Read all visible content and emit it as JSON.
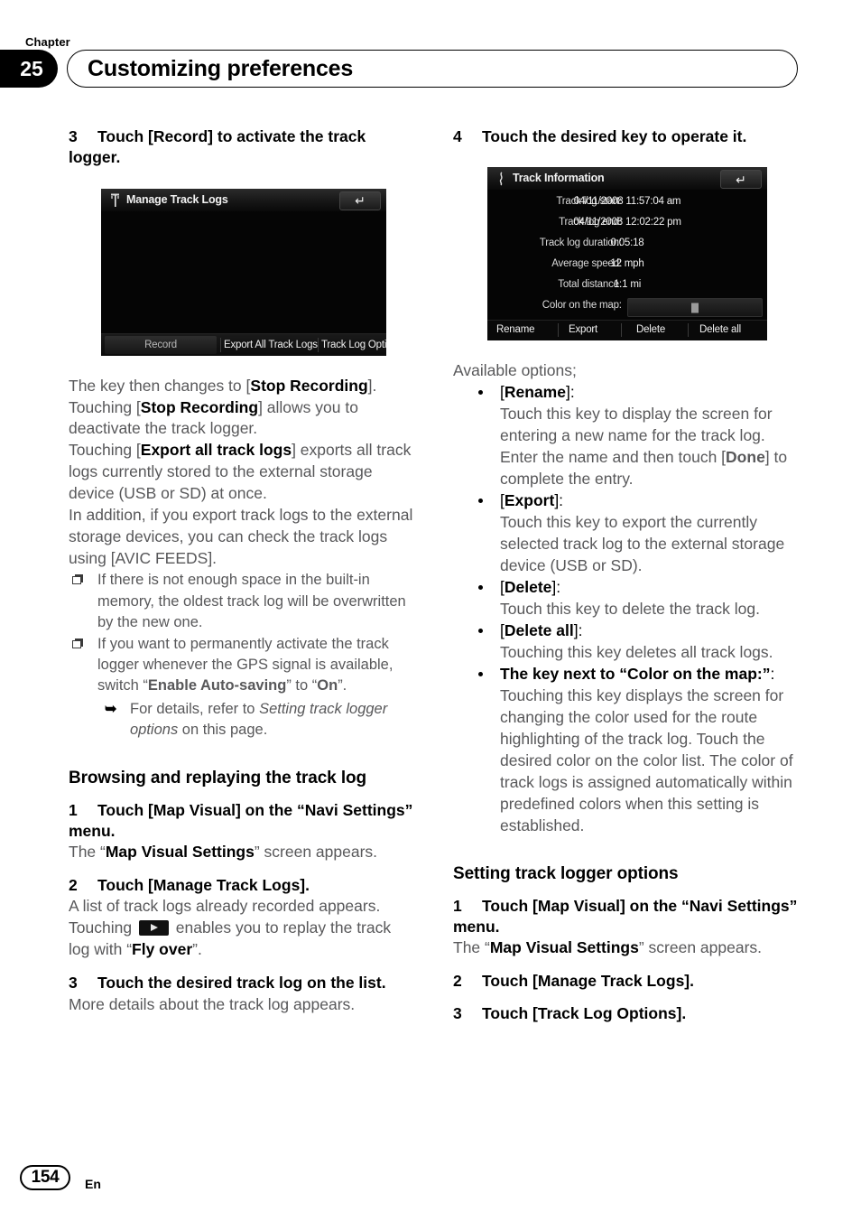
{
  "header": {
    "chapter_label": "Chapter",
    "chapter_number": "25",
    "title": "Customizing preferences"
  },
  "left_column": {
    "step3": {
      "number": "3",
      "text": "Touch [Record] to activate the track logger."
    },
    "screenshot_manage_track_logs": {
      "title": "Manage Track Logs",
      "title_icon": "track-log-icon",
      "back_icon": "back-arrow-icon",
      "keys": {
        "record": "Record",
        "export_all": "Export All Track Logs",
        "options": "Track Log Options"
      }
    },
    "body_paragraph_1": "The key then changes to [Stop Recording]. Touching [Stop Recording] allows you to deactivate the track logger.",
    "body_paragraph_1_parts": {
      "a": "The key then changes to [",
      "b1": "Stop Recording",
      "c": "]. Touching [",
      "b2": "Stop Recording",
      "d": "] allows you to deactivate the track logger."
    },
    "body_paragraph_2_parts": {
      "a": "Touching [",
      "b": "Export all track logs",
      "c": "] exports all track logs currently stored to the external storage device (USB or SD) at once."
    },
    "body_paragraph_3": "In addition, if you export track logs to the external storage devices, you can check the track logs using [AVIC FEEDS].",
    "notes": [
      {
        "marker": "note-cube-icon",
        "text": "If there is not enough space in the built-in memory, the oldest track log will be overwritten by the new one."
      },
      {
        "marker": "note-cube-icon",
        "parts": {
          "a": "If you want to permanently activate the track logger whenever the GPS signal is available, switch “",
          "b": "Enable Auto-saving",
          "c": "” to “",
          "d": "On",
          "e": "”."
        }
      }
    ],
    "xref": {
      "icon": "xref-arrow-icon",
      "a": "For details, refer to ",
      "italic": "Setting track logger options",
      "b": " on this page."
    },
    "section_heading": "Browsing and replaying the track log",
    "step1": {
      "number": "1",
      "text": "Touch [Map Visual] on the “Navi Settings” menu."
    },
    "step1_body": {
      "a": "The “",
      "b": "Map Visual Settings",
      "c": "” screen appears."
    },
    "step2": {
      "number": "2",
      "text": "Touch [Manage Track Logs]."
    },
    "step2_body_line1": "A list of track logs already recorded appears.",
    "step2_body_line2": {
      "a": "Touching ",
      "icon": "play-key-icon",
      "b": " enables you to replay the track log with “",
      "bold": "Fly over",
      "c": "”."
    },
    "step3b": {
      "number": "3",
      "text": "Touch the desired track log on the list."
    },
    "step3b_body": "More details about the track log appears."
  },
  "right_column": {
    "step4": {
      "number": "4",
      "text": "Touch the desired key to operate it."
    },
    "screenshot_track_information": {
      "title": "Track Information",
      "title_icon": "track-log-icon",
      "back_icon": "back-arrow-icon",
      "rows": [
        {
          "label": "Track log start:",
          "value": "04/11/2008 11:57:04 am"
        },
        {
          "label": "Track log end:",
          "value": "04/11/2008 12:02:22 pm"
        },
        {
          "label": "Track log duration:",
          "value": "0:05:18"
        },
        {
          "label": "Average speed:",
          "value": "12 mph"
        },
        {
          "label": "Total distance:",
          "value": "1.1 mi"
        },
        {
          "label": "Color on the map:",
          "value": ""
        }
      ],
      "keys": {
        "rename": "Rename",
        "export": "Export",
        "delete": "Delete",
        "delete_all": "Delete all"
      }
    },
    "available_options_label": "Available options;",
    "options": [
      {
        "label_open": "[",
        "label_bold": "Rename",
        "label_close": "]:",
        "description": "Touch this key to display the screen for entering a new name for the track log. Enter the name and then touch [Done] to complete the entry.",
        "desc_parts": {
          "a": "Touch this key to display the screen for entering a new name for the track log. Enter the name and then touch [",
          "b": "Done",
          "c": "] to complete the entry."
        }
      },
      {
        "label_open": "[",
        "label_bold": "Export",
        "label_close": "]:",
        "description": "Touch this key to export the currently selected track log to the external storage device (USB or SD)."
      },
      {
        "label_open": "[",
        "label_bold": "Delete",
        "label_close": "]:",
        "description": "Touch this key to delete the track log."
      },
      {
        "label_open": "[",
        "label_bold": "Delete all",
        "label_close": "]:",
        "description": "Touching this key deletes all track logs."
      },
      {
        "label_open": "",
        "label_bold": "The key next to “Color on the map:”",
        "label_close": ":",
        "description": "Touching this key displays the screen for changing the color used for the route highlighting of the track log. Touch the desired color on the color list. The color of track logs is assigned automatically within predefined colors when this setting is established."
      }
    ],
    "section_heading": "Setting track logger options",
    "step1": {
      "number": "1",
      "text": "Touch [Map Visual] on the “Navi Settings” menu."
    },
    "step1_body": {
      "a": "The “",
      "b": "Map Visual Settings",
      "c": "” screen appears."
    },
    "step2": {
      "number": "2",
      "text": "Touch [Manage Track Logs]."
    },
    "step3": {
      "number": "3",
      "text": "Touch [Track Log Options]."
    }
  },
  "footer": {
    "page_number": "154",
    "language": "En"
  }
}
